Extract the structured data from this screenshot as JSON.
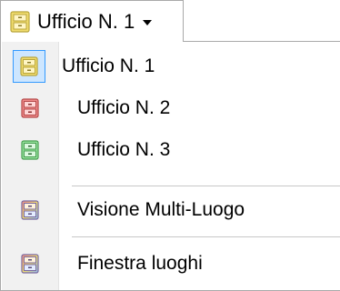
{
  "dropdown": {
    "label": "Ufficio N. 1",
    "icon": "cabinet-yellow-icon",
    "caret_icon": "caret-down-icon"
  },
  "menu": {
    "items": [
      {
        "label": "Ufficio N. 1",
        "icon": "cabinet-yellow-icon",
        "checked": true
      },
      {
        "label": "Ufficio N. 2",
        "icon": "cabinet-red-icon",
        "checked": false
      },
      {
        "label": "Ufficio N. 3",
        "icon": "cabinet-green-icon",
        "checked": false
      },
      {
        "label": "Visione Multi-Luogo",
        "icon": "cabinet-multicolor-icon",
        "checked": false
      },
      {
        "label": "Finestra luoghi",
        "icon": "cabinet-multicolor-icon",
        "checked": false
      }
    ]
  },
  "colors": {
    "checked_highlight_bg": "#cde6ff",
    "checked_highlight_border": "#3399ff",
    "yellow_cabinet": "#f0dc6e",
    "red_cabinet": "#ee8a8a",
    "green_cabinet": "#93e09b"
  }
}
